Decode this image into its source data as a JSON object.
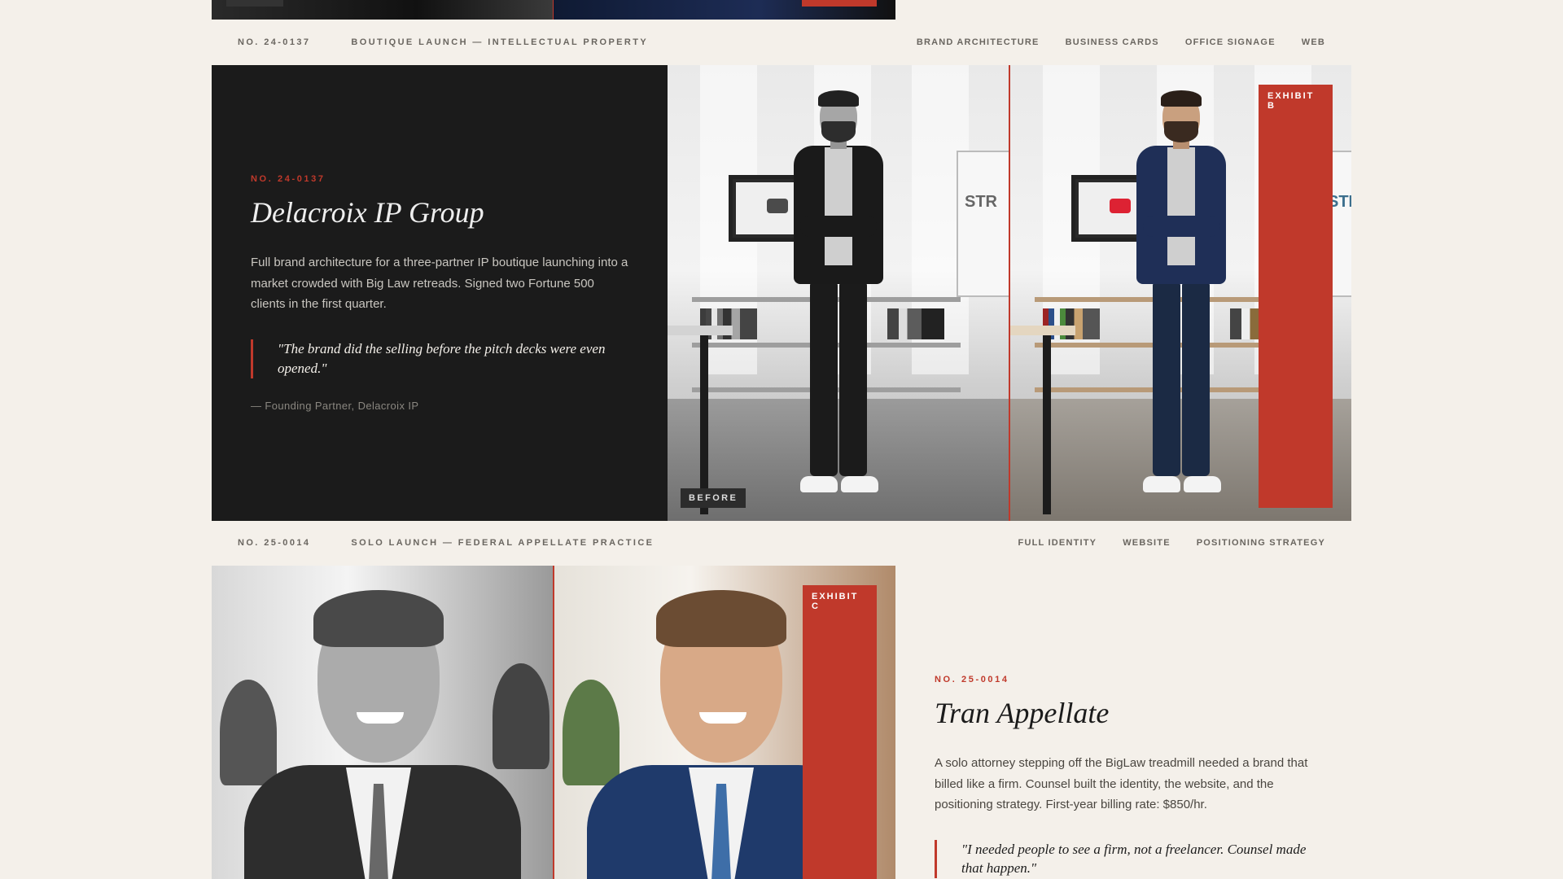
{
  "colors": {
    "accent": "#c0392b",
    "dark_panel": "#1b1b1b",
    "page_bg": "#f4f0ea"
  },
  "case1": {
    "meta": {
      "number": "NO. 24-0137",
      "category": "BOUTIQUE LAUNCH — INTELLECTUAL PROPERTY",
      "services": [
        "BRAND ARCHITECTURE",
        "BUSINESS CARDS",
        "OFFICE SIGNAGE",
        "WEB"
      ]
    },
    "number": "NO. 24-0137",
    "title": "Delacroix IP Group",
    "description": "Full brand architecture for a three-partner IP boutique launching into a market crowded with Big Law retreads. Signed two Fortune 500 clients in the first quarter.",
    "quote": "\"The brand did the selling before the pitch decks were even opened.\"",
    "attribution": "— Founding Partner, Delacroix IP",
    "before_label": "BEFORE",
    "exhibit_label": "EXHIBIT B",
    "board_text": "STR"
  },
  "case2": {
    "meta": {
      "number": "NO. 25-0014",
      "category": "SOLO LAUNCH — FEDERAL APPELLATE PRACTICE",
      "services": [
        "FULL IDENTITY",
        "WEBSITE",
        "POSITIONING STRATEGY"
      ]
    },
    "number": "NO. 25-0014",
    "title": "Tran Appellate",
    "description": "A solo attorney stepping off the BigLaw treadmill needed a brand that billed like a firm. Counsel built the identity, the website, and the positioning strategy. First-year billing rate: $850/hr.",
    "quote": "\"I needed people to see a firm, not a freelancer. Counsel made that happen.\"",
    "exhibit_label": "EXHIBIT C"
  }
}
